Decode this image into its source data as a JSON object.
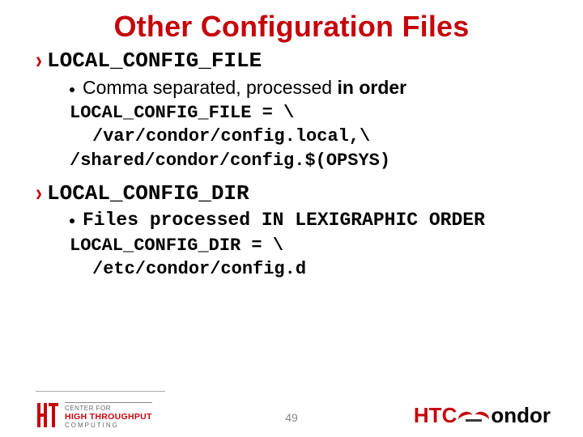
{
  "title": "Other Configuration Files",
  "sections": [
    {
      "heading": "LOCAL_CONFIG_FILE",
      "bullet_prefix": "Comma separated, processed ",
      "bullet_bold": "in order",
      "code": {
        "l1": "LOCAL_CONFIG_FILE = \\",
        "l2": "/var/condor/config.local,\\",
        "l3": "/shared/condor/config.$(OPSYS)"
      }
    },
    {
      "heading": "LOCAL_CONFIG_DIR",
      "bullet_mono": "Files processed IN LEXIGRAPHIC ORDER",
      "code": {
        "l1": "LOCAL_CONFIG_DIR = \\",
        "l2": "/etc/condor/config.d"
      }
    }
  ],
  "footer": {
    "left": {
      "line1": "CENTER FOR",
      "line2": "HIGH THROUGHPUT",
      "line3": "COMPUTING"
    },
    "page_number": "49",
    "right": {
      "part1": "HTC",
      "part2": "ondor"
    }
  }
}
